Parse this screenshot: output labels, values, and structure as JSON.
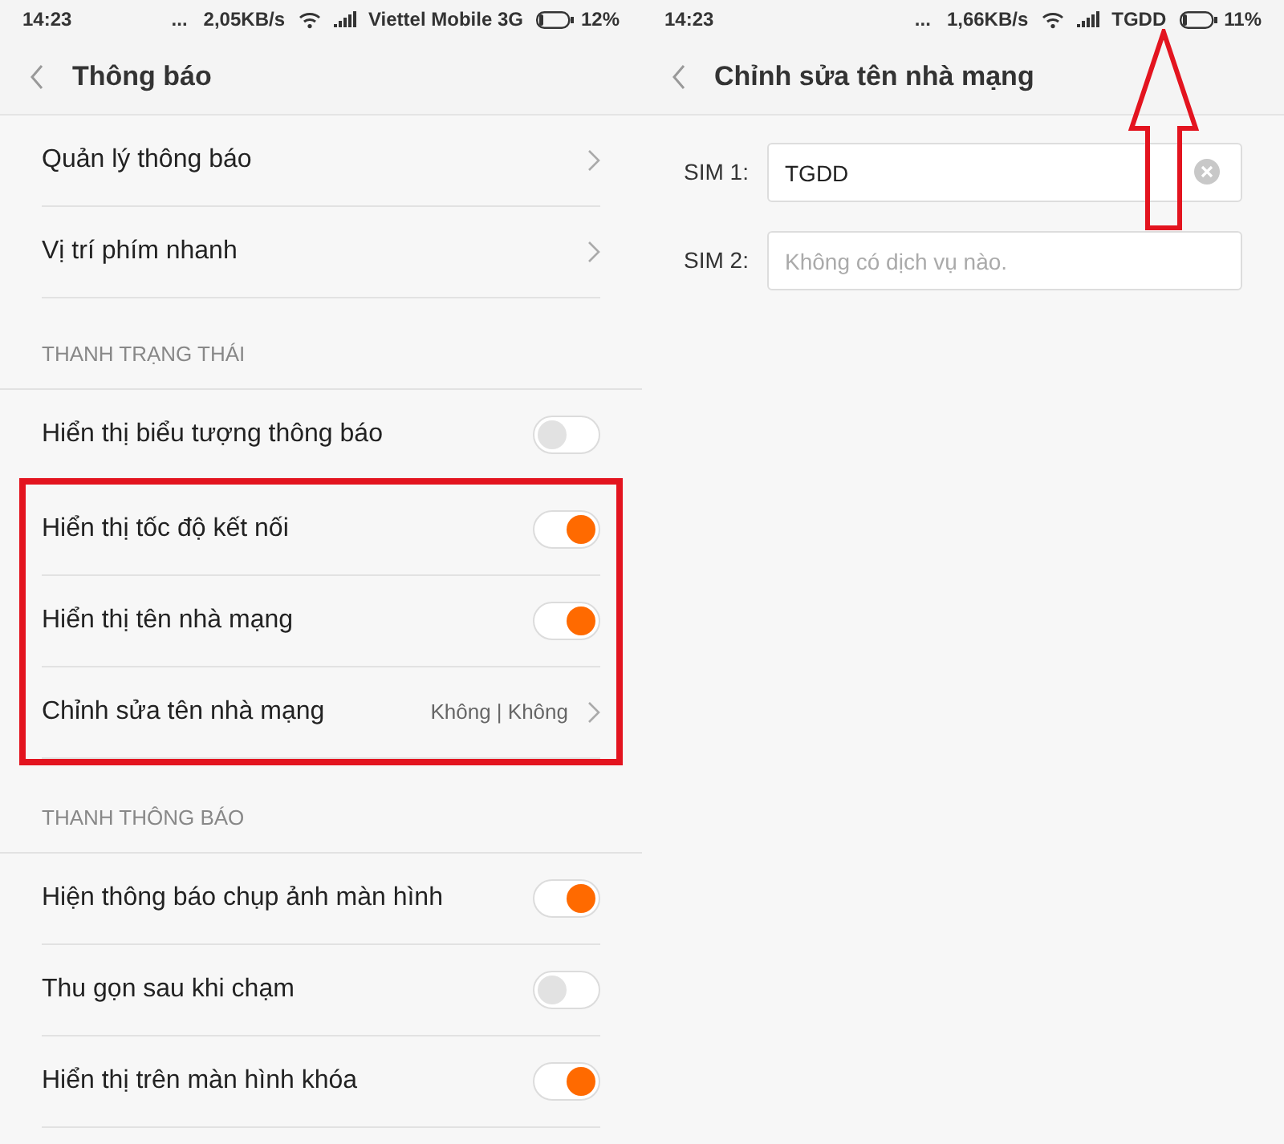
{
  "left": {
    "status_bar": {
      "time": "14:23",
      "dots": "...",
      "speed": "2,05KB/s",
      "carrier": "Viettel Mobile 3G",
      "battery": "12%"
    },
    "title": "Thông báo",
    "sections": [
      {
        "items": [
          {
            "kind": "link",
            "label": "Quản lý thông báo",
            "highlighted": false
          },
          {
            "kind": "link",
            "label": "Vị trí phím nhanh",
            "highlighted": false
          }
        ]
      },
      {
        "title": "THANH TRẠNG THÁI",
        "items": [
          {
            "kind": "toggle",
            "label": "Hiển thị biểu tượng thông báo",
            "on": false,
            "highlighted": false
          },
          {
            "kind": "toggle",
            "label": "Hiển thị tốc độ kết nối",
            "on": true,
            "highlighted": true
          },
          {
            "kind": "toggle",
            "label": "Hiển thị tên nhà mạng",
            "on": true,
            "highlighted": true
          },
          {
            "kind": "link",
            "label": "Chỉnh sửa tên nhà mạng",
            "value": "Không | Không",
            "highlighted": true
          }
        ]
      },
      {
        "title": "THANH THÔNG BÁO",
        "items": [
          {
            "kind": "toggle",
            "label": "Hiện thông báo chụp ảnh màn hình",
            "on": true,
            "highlighted": false
          },
          {
            "kind": "toggle",
            "label": "Thu gọn sau khi chạm",
            "on": false,
            "highlighted": false
          },
          {
            "kind": "toggle",
            "label": "Hiển thị trên màn hình khóa",
            "on": true,
            "highlighted": false
          }
        ]
      }
    ]
  },
  "right": {
    "status_bar": {
      "time": "14:23",
      "dots": "...",
      "speed": "1,66KB/s",
      "carrier": "TGDD",
      "battery": "11%"
    },
    "title": "Chỉnh sửa tên nhà mạng",
    "fields": [
      {
        "label": "SIM 1:",
        "value": "TGDD"
      },
      {
        "label": "SIM 2:",
        "placeholder": "Không có dịch vụ nào."
      }
    ]
  }
}
